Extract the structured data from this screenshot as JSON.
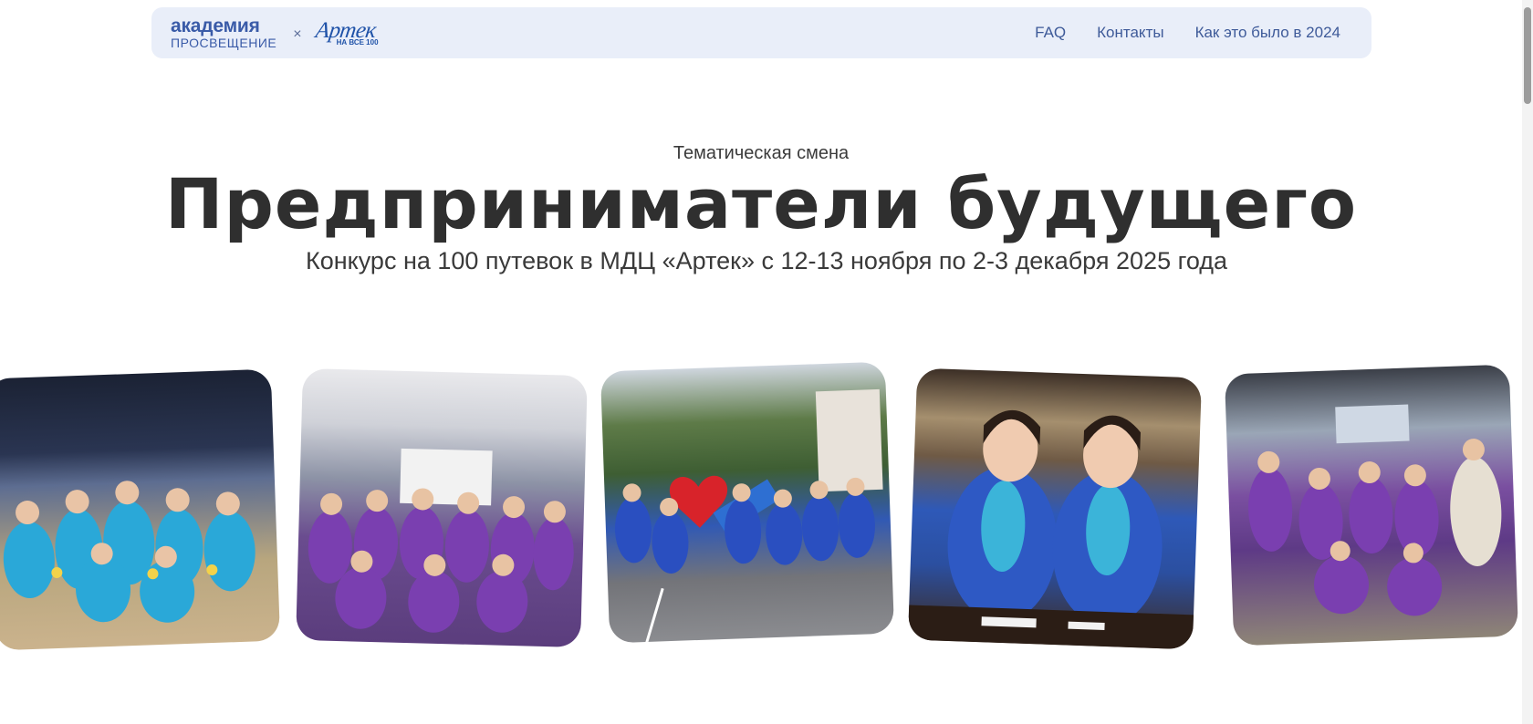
{
  "header": {
    "logo_academy_line1": "академия",
    "logo_academy_line2": "ПРОСВЕЩЕНИЕ",
    "logo_separator": "×",
    "logo_artek_script": "Артек",
    "logo_artek_sub": "НА ВСЕ 100",
    "nav": [
      {
        "label": "FAQ"
      },
      {
        "label": "Контакты"
      },
      {
        "label": "Как это было в 2024"
      }
    ]
  },
  "hero": {
    "eyebrow": "Тематическая смена",
    "title": "Предприниматели будущего",
    "subtitle": "Конкурс на 100 путевок в МДЦ «Артек» с 12-13 ноября по 2-3 декабря 2025 года"
  },
  "gallery": {
    "photos": [
      {
        "description": "group-photo-stage-light-blue"
      },
      {
        "description": "group-photo-classroom-purple"
      },
      {
        "description": "group-photo-outdoor-artek-sign"
      },
      {
        "description": "two-girls-smiling-blue-jackets"
      },
      {
        "description": "group-photo-purple-shirts"
      }
    ]
  },
  "colors": {
    "header_bg": "#e9eef9",
    "nav_text": "#3e5a99",
    "brand_blue": "#3a5ba8",
    "title_text": "#2f2f2f"
  }
}
